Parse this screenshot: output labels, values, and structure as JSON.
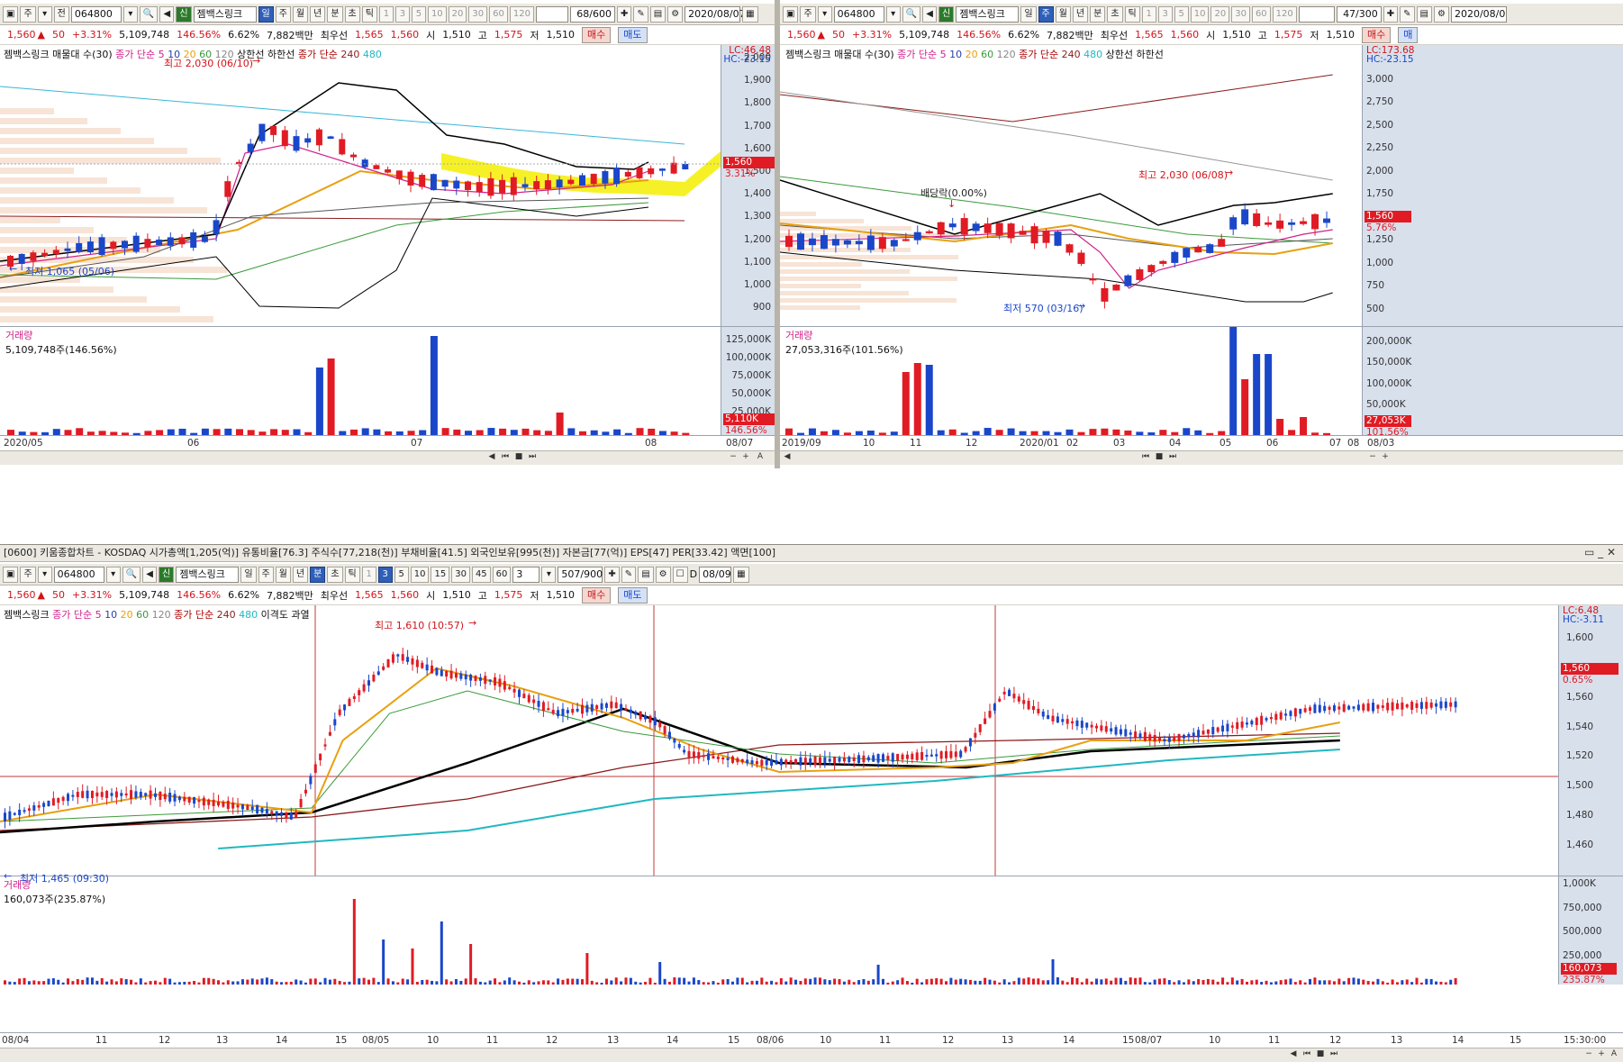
{
  "left_win": {
    "toolbar": {
      "type": "주",
      "market": "전",
      "code": "064800",
      "name": "젬백스링크",
      "periods": [
        "일",
        "주",
        "월",
        "년",
        "분",
        "초",
        "틱"
      ],
      "selected": "일",
      "nums": [
        "1",
        "3",
        "5",
        "10",
        "20",
        "30",
        "60",
        "120"
      ],
      "count": "68/600",
      "date": "2020/08/07"
    },
    "quote": {
      "price": "1,560",
      "change": "50",
      "pct": "+3.31%",
      "volume": "5,109,748",
      "vol_ratio": "146.56%",
      "turnover": "6.62%",
      "amount": "7,882백만",
      "pref_label": "최우선",
      "ask": "1,565",
      "bid": "1,560",
      "open_label": "시",
      "open": "1,510",
      "high_label": "고",
      "high": "1,575",
      "low_label": "저",
      "low": "1,510",
      "buy": "매수",
      "sell": "매도"
    },
    "legend": {
      "name": "젬백스링크 매물대 수(30)",
      "ma_label": "종가 단순",
      "ma": [
        "5",
        "10",
        "20",
        "60",
        "120"
      ],
      "limits": "상한선 하한선",
      "ma2_label": "종가 단순",
      "ma2": [
        "240",
        "480"
      ]
    },
    "lc": "LC:46.48",
    "hc": "HC:-23.15",
    "yaxis": [
      "2,000",
      "1,900",
      "1,800",
      "1,700",
      "1,600",
      "1,500",
      "1,400",
      "1,300",
      "1,200",
      "1,100",
      "1,000",
      "900"
    ],
    "price_tag": "1,560",
    "pct_tag": "3.31%",
    "high_ann": "최고 2,030 (06/10)",
    "low_ann": "최저 1,065 (05/06)",
    "vol_title": "거래량",
    "vol_value": "5,109,748주(146.56%)",
    "vol_axis": [
      "125,000K",
      "100,000K",
      "75,000K",
      "50,000K",
      "25,000K"
    ],
    "vol_tag": "5,110K",
    "vol_pct": "146.56%",
    "xaxis": [
      "2020/05",
      "06",
      "07",
      "08"
    ],
    "x_end": "08/07"
  },
  "right_win": {
    "toolbar": {
      "type": "주",
      "code": "064800",
      "name": "젬백스링크",
      "periods": [
        "일",
        "주",
        "월",
        "년",
        "분",
        "초",
        "틱"
      ],
      "selected": "주",
      "nums": [
        "1",
        "3",
        "5",
        "10",
        "20",
        "30",
        "60",
        "120"
      ],
      "count": "47/300",
      "date": "2020/08/0"
    },
    "quote": {
      "price": "1,560",
      "change": "50",
      "pct": "+3.31%",
      "volume": "5,109,748",
      "vol_ratio": "146.56%",
      "turnover": "6.62%",
      "amount": "7,882백만",
      "pref_label": "최우선",
      "ask": "1,565",
      "bid": "1,560",
      "open_label": "시",
      "open": "1,510",
      "high_label": "고",
      "high": "1,575",
      "low_label": "저",
      "low": "1,510",
      "buy": "매수",
      "sell": "매"
    },
    "legend": {
      "name": "젬백스링크 매물대 수(30)",
      "ma_label": "종가 단순",
      "ma": [
        "5",
        "10",
        "20",
        "60",
        "120"
      ],
      "ma2_label": "종가 단순",
      "ma2": [
        "240",
        "480"
      ],
      "limits": "상한선 하한선"
    },
    "lc": "LC:173.68",
    "hc": "HC:-23.15",
    "yaxis": [
      "3,000",
      "2,750",
      "2,500",
      "2,250",
      "2,000",
      "1,750",
      "1,500",
      "1,250",
      "1,000",
      "750",
      "500"
    ],
    "price_tag": "1,560",
    "pct_tag": "5.76%",
    "high_ann": "최고 2,030 (06/08)",
    "low_ann": "최저 570 (03/16)",
    "div_ann": "배당락(0.00%)",
    "vol_title": "거래량",
    "vol_value": "27,053,316주(101.56%)",
    "vol_axis": [
      "200,000K",
      "150,000K",
      "100,000K",
      "50,000K"
    ],
    "vol_tag": "27,053K",
    "vol_pct": "101.56%",
    "xaxis": [
      "2019/09",
      "10",
      "11",
      "12",
      "2020/01",
      "02",
      "03",
      "04",
      "05",
      "06",
      "07",
      "08"
    ],
    "x_end": "08/03"
  },
  "bottom_win": {
    "title": "[0600] 키움종합차트 - KOSDAQ 시가총액[1,205(억)] 유통비율[76.3] 주식수[77,218(천)] 부채비율[41.5] 외국인보유[995(천)] 자본금[77(억)] EPS[47] PER[33.42] 액면[100]",
    "toolbar": {
      "type": "주",
      "code": "064800",
      "name": "젬백스링크",
      "periods": [
        "일",
        "주",
        "월",
        "년",
        "분",
        "초",
        "틱"
      ],
      "selected": "분",
      "nums": [
        "1",
        "3",
        "5",
        "10",
        "15",
        "30",
        "45",
        "60"
      ],
      "sel_num": "3",
      "interval": "3",
      "count": "507/900",
      "d_label": "D",
      "date": "08/09"
    },
    "quote": {
      "price": "1,560",
      "change": "50",
      "pct": "+3.31%",
      "volume": "5,109,748",
      "vol_ratio": "146.56%",
      "turnover": "6.62%",
      "amount": "7,882백만",
      "pref_label": "최우선",
      "ask": "1,565",
      "bid": "1,560",
      "open_label": "시",
      "open": "1,510",
      "high_label": "고",
      "high": "1,575",
      "low_label": "저",
      "low": "1,510",
      "buy": "매수",
      "sell": "매도"
    },
    "legend": {
      "name": "젬백스링크",
      "ma_label": "종가 단순",
      "ma": [
        "5",
        "10",
        "20",
        "60",
        "120"
      ],
      "ma2_label": "종가 단순",
      "ma2": [
        "240",
        "480"
      ],
      "disparity": "이격도 과열"
    },
    "lc": "LC:6.48",
    "hc": "HC:-3.11",
    "yaxis": [
      "1,600",
      "1,580",
      "1,560",
      "1,540",
      "1,520",
      "1,500",
      "1,480",
      "1,460"
    ],
    "price_tag": "1,560",
    "pct_tag": "0.65%",
    "high_ann": "최고 1,610 (10:57)",
    "low_ann": "최저 1,465 (09:30)",
    "vol_title": "거래량",
    "vol_value": "160,073주(235.87%)",
    "vol_axis": [
      "1,000K",
      "750,000",
      "500,000",
      "250,000"
    ],
    "vol_tag": "160,073",
    "vol_pct": "235.87%",
    "xaxis": [
      "08/04",
      "11",
      "12",
      "13",
      "14",
      "15",
      "08/05",
      "10",
      "11",
      "12",
      "13",
      "14",
      "15",
      "08/06",
      "10",
      "11",
      "12",
      "13",
      "14",
      "15",
      "08/07",
      "10",
      "11",
      "12",
      "13",
      "14",
      "15"
    ],
    "x_end": "15:30:00"
  },
  "colors": {
    "up": "#e01b24",
    "down": "#1a47c9",
    "ma5": "#d0208a",
    "ma20": "#e8a010",
    "ma60": "#3a9a3a",
    "ma240": "#20b8c0",
    "bb": "#000000",
    "highlight": "#f5ef00",
    "axis_bg": "#d8e0ec"
  }
}
